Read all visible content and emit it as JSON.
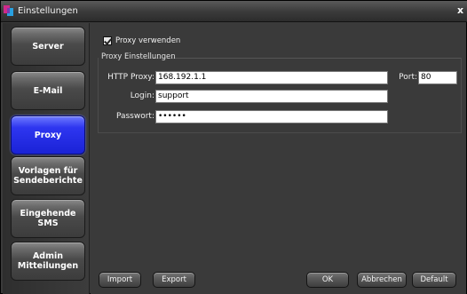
{
  "window": {
    "title": "Einstellungen",
    "close_glyph": "x"
  },
  "sidebar": {
    "items": [
      {
        "label": "Server",
        "active": false
      },
      {
        "label": "E-Mail",
        "active": false
      },
      {
        "label": "Proxy",
        "active": true
      },
      {
        "label": "Vorlagen für Sendeberichte",
        "active": false
      },
      {
        "label": "Eingehende SMS",
        "active": false
      },
      {
        "label": "Admin Mitteilungen",
        "active": false
      }
    ]
  },
  "proxy": {
    "use_proxy_label": "Proxy verwenden",
    "use_proxy_checked": true,
    "group_title": "Proxy Einstellungen",
    "http_proxy_label": "HTTP Proxy:",
    "http_proxy_value": "168.192.1.1",
    "port_label": "Port:",
    "port_value": "80",
    "login_label": "Login:",
    "login_value": "support",
    "password_label": "Passwort:",
    "password_value": "••••••"
  },
  "buttons": {
    "import": "Import",
    "export": "Export",
    "ok": "OK",
    "cancel": "Abbrechen",
    "default": "Default"
  },
  "colors": {
    "active_nav": "#1a22d6",
    "background": "#3a3a3a"
  }
}
